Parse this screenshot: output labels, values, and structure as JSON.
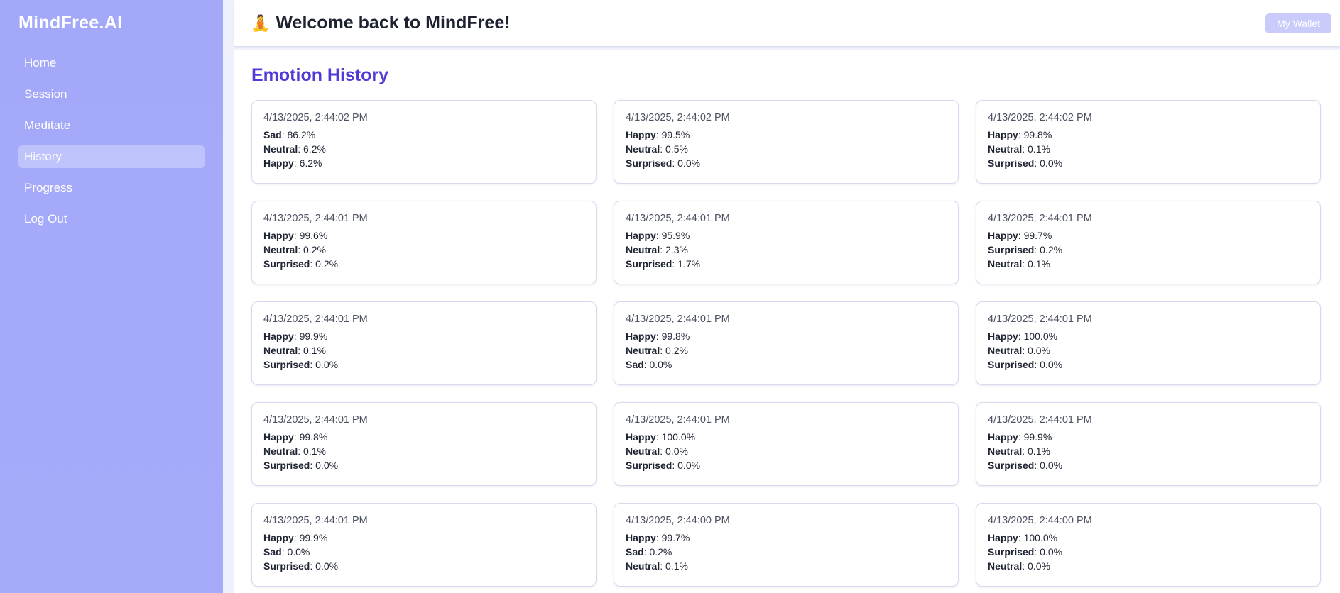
{
  "sidebar": {
    "brand": "MindFree.AI",
    "items": [
      {
        "label": "Home",
        "active": false
      },
      {
        "label": "Session",
        "active": false
      },
      {
        "label": "Meditate",
        "active": false
      },
      {
        "label": "History",
        "active": true
      },
      {
        "label": "Progress",
        "active": false
      },
      {
        "label": "Log Out",
        "active": false
      }
    ]
  },
  "header": {
    "emoji": "🧘",
    "title": "Welcome back to MindFree!",
    "wallet_label": "My Wallet"
  },
  "main": {
    "section_title": "Emotion History",
    "cards": [
      {
        "time": "4/13/2025, 2:44:02 PM",
        "emotions": [
          {
            "name": "Sad",
            "value": "86.2%"
          },
          {
            "name": "Neutral",
            "value": "6.2%"
          },
          {
            "name": "Happy",
            "value": "6.2%"
          }
        ]
      },
      {
        "time": "4/13/2025, 2:44:02 PM",
        "emotions": [
          {
            "name": "Happy",
            "value": "99.5%"
          },
          {
            "name": "Neutral",
            "value": "0.5%"
          },
          {
            "name": "Surprised",
            "value": "0.0%"
          }
        ]
      },
      {
        "time": "4/13/2025, 2:44:02 PM",
        "emotions": [
          {
            "name": "Happy",
            "value": "99.8%"
          },
          {
            "name": "Neutral",
            "value": "0.1%"
          },
          {
            "name": "Surprised",
            "value": "0.0%"
          }
        ]
      },
      {
        "time": "4/13/2025, 2:44:01 PM",
        "emotions": [
          {
            "name": "Happy",
            "value": "99.6%"
          },
          {
            "name": "Neutral",
            "value": "0.2%"
          },
          {
            "name": "Surprised",
            "value": "0.2%"
          }
        ]
      },
      {
        "time": "4/13/2025, 2:44:01 PM",
        "emotions": [
          {
            "name": "Happy",
            "value": "95.9%"
          },
          {
            "name": "Neutral",
            "value": "2.3%"
          },
          {
            "name": "Surprised",
            "value": "1.7%"
          }
        ]
      },
      {
        "time": "4/13/2025, 2:44:01 PM",
        "emotions": [
          {
            "name": "Happy",
            "value": "99.7%"
          },
          {
            "name": "Surprised",
            "value": "0.2%"
          },
          {
            "name": "Neutral",
            "value": "0.1%"
          }
        ]
      },
      {
        "time": "4/13/2025, 2:44:01 PM",
        "emotions": [
          {
            "name": "Happy",
            "value": "99.9%"
          },
          {
            "name": "Neutral",
            "value": "0.1%"
          },
          {
            "name": "Surprised",
            "value": "0.0%"
          }
        ]
      },
      {
        "time": "4/13/2025, 2:44:01 PM",
        "emotions": [
          {
            "name": "Happy",
            "value": "99.8%"
          },
          {
            "name": "Neutral",
            "value": "0.2%"
          },
          {
            "name": "Sad",
            "value": "0.0%"
          }
        ]
      },
      {
        "time": "4/13/2025, 2:44:01 PM",
        "emotions": [
          {
            "name": "Happy",
            "value": "100.0%"
          },
          {
            "name": "Neutral",
            "value": "0.0%"
          },
          {
            "name": "Surprised",
            "value": "0.0%"
          }
        ]
      },
      {
        "time": "4/13/2025, 2:44:01 PM",
        "emotions": [
          {
            "name": "Happy",
            "value": "99.8%"
          },
          {
            "name": "Neutral",
            "value": "0.1%"
          },
          {
            "name": "Surprised",
            "value": "0.0%"
          }
        ]
      },
      {
        "time": "4/13/2025, 2:44:01 PM",
        "emotions": [
          {
            "name": "Happy",
            "value": "100.0%"
          },
          {
            "name": "Neutral",
            "value": "0.0%"
          },
          {
            "name": "Surprised",
            "value": "0.0%"
          }
        ]
      },
      {
        "time": "4/13/2025, 2:44:01 PM",
        "emotions": [
          {
            "name": "Happy",
            "value": "99.9%"
          },
          {
            "name": "Neutral",
            "value": "0.1%"
          },
          {
            "name": "Surprised",
            "value": "0.0%"
          }
        ]
      },
      {
        "time": "4/13/2025, 2:44:01 PM",
        "emotions": [
          {
            "name": "Happy",
            "value": "99.9%"
          },
          {
            "name": "Sad",
            "value": "0.0%"
          },
          {
            "name": "Surprised",
            "value": "0.0%"
          }
        ]
      },
      {
        "time": "4/13/2025, 2:44:00 PM",
        "emotions": [
          {
            "name": "Happy",
            "value": "99.7%"
          },
          {
            "name": "Sad",
            "value": "0.2%"
          },
          {
            "name": "Neutral",
            "value": "0.1%"
          }
        ]
      },
      {
        "time": "4/13/2025, 2:44:00 PM",
        "emotions": [
          {
            "name": "Happy",
            "value": "100.0%"
          },
          {
            "name": "Surprised",
            "value": "0.0%"
          },
          {
            "name": "Neutral",
            "value": "0.0%"
          }
        ]
      }
    ]
  },
  "colors": {
    "sidebar_bg": "#a3a8f9",
    "accent": "#4f3bd6",
    "wallet_button": "#c9ccfb"
  }
}
